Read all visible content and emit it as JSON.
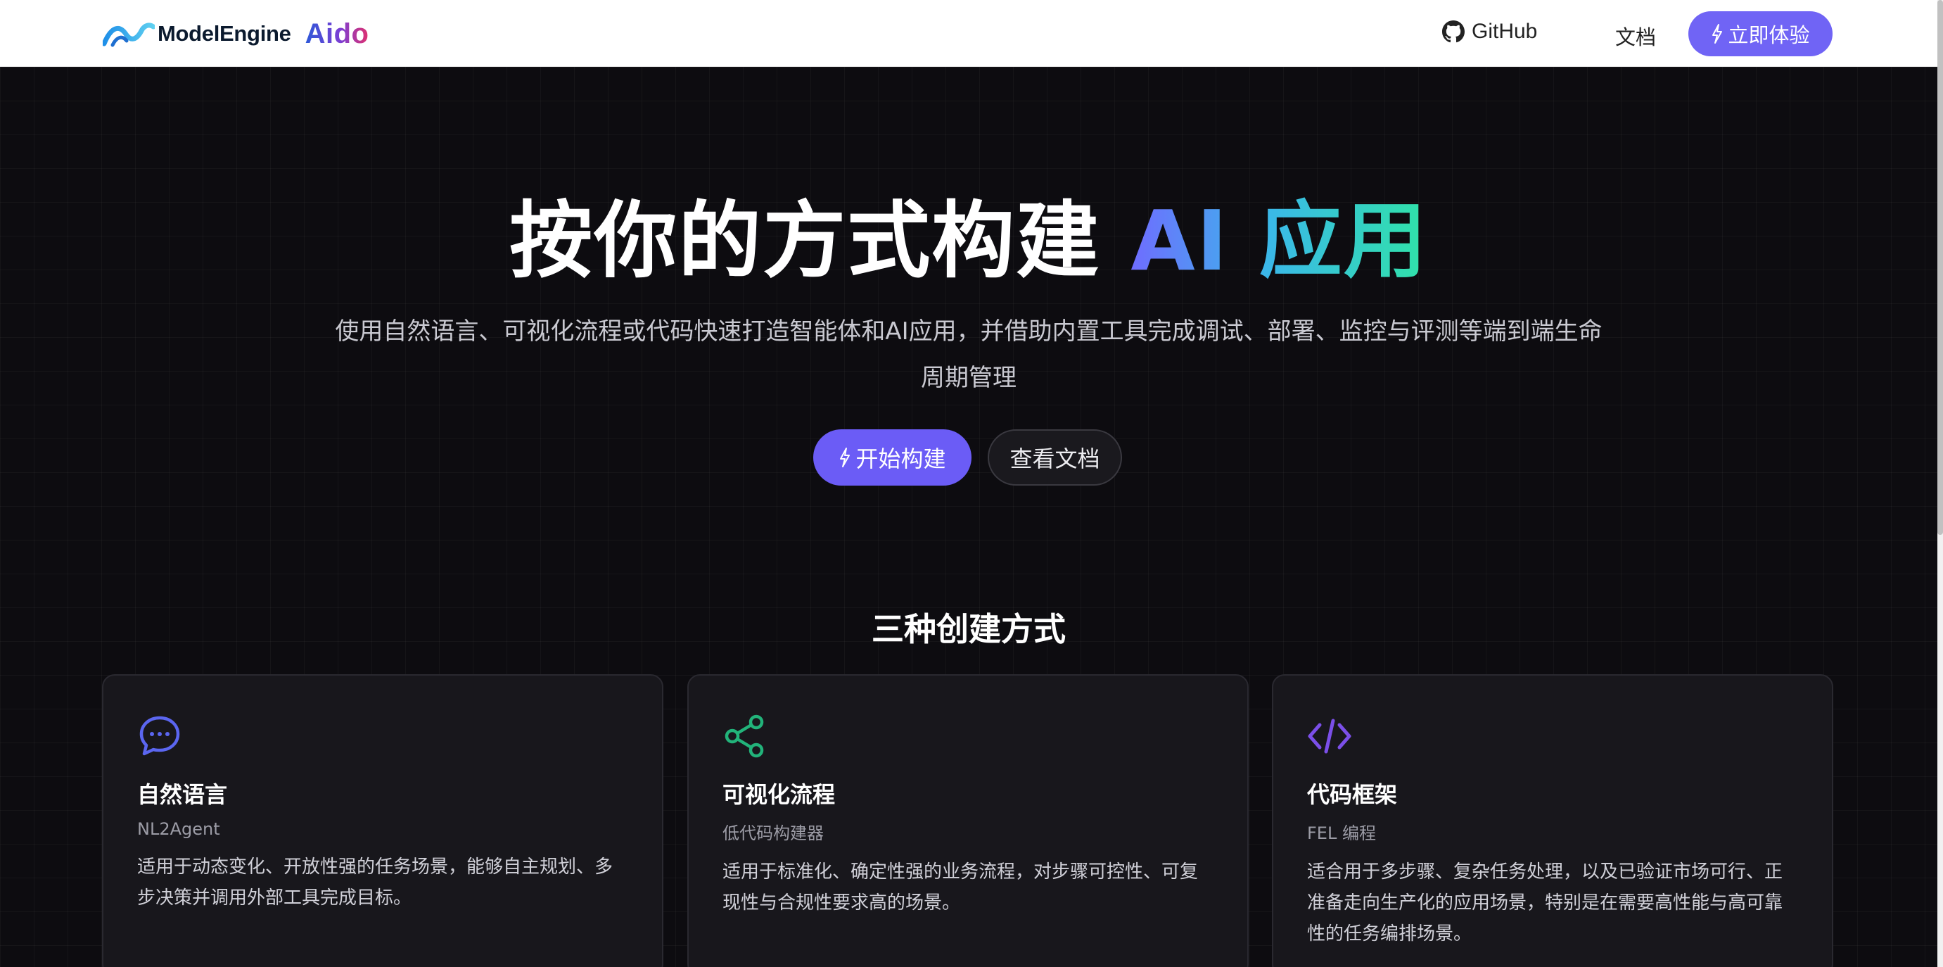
{
  "header": {
    "logo_text": "ModelEngine",
    "logo_aido": "Aido",
    "github_label": "GitHub",
    "docs_label": "文档",
    "try_button_label": "立即体验"
  },
  "hero": {
    "title_plain": "按你的方式构建",
    "title_gradient": "AI 应用",
    "subtitle_line1": "使用自然语言、可视化流程或代码快速打造智能体和AI应用，并借助内置工具完成调试、部署、监控与评测等端到端生命",
    "subtitle_line2": "周期管理",
    "start_button_label": "开始构建",
    "docs_button_label": "查看文档"
  },
  "section": {
    "title": "三种创建方式"
  },
  "cards": [
    {
      "icon": "chat-bubble-icon",
      "title": "自然语言",
      "subtitle": "NL2Agent",
      "description": "适用于动态变化、开放性强的任务场景，能够自主规划、多步决策并调用外部工具完成目标。"
    },
    {
      "icon": "share-nodes-icon",
      "title": "可视化流程",
      "subtitle": "低代码构建器",
      "description": "适用于标准化、确定性强的业务流程，对步骤可控性、可复现性与合规性要求高的场景。"
    },
    {
      "icon": "code-icon",
      "title": "代码框架",
      "subtitle": "FEL 编程",
      "description": "适合用于多步骤、复杂任务处理，以及已验证市场可行、正准备走向生产化的应用场景，特别是在需要高性能与高可靠性的任务编排场景。"
    }
  ],
  "colors": {
    "accent": "#6b5cf6",
    "page_bg": "#0d0c10",
    "card_bg": "#18171c",
    "icon_blue": "#5b66f0",
    "icon_green": "#22b37a",
    "icon_purple": "#7b4fe8"
  }
}
